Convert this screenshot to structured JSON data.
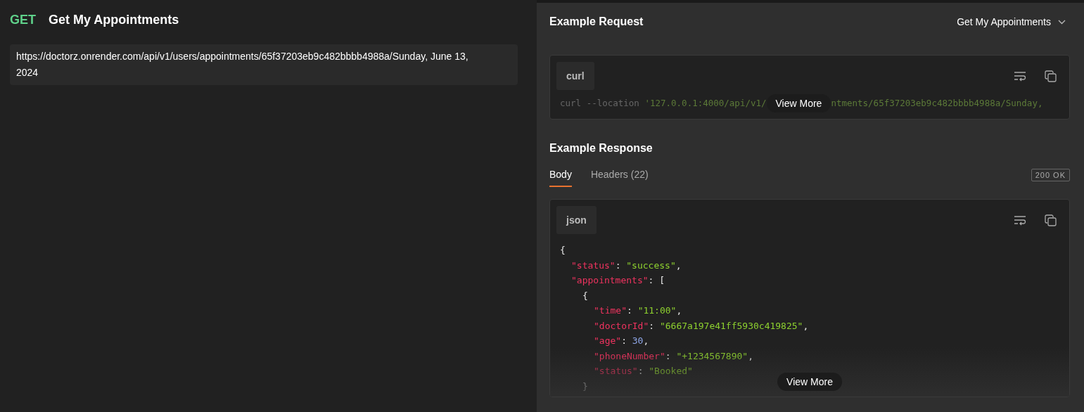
{
  "request": {
    "method": "GET",
    "name": "Get My Appointments",
    "url": "https://doctorz.onrender.com/api/v1/users/appointments/65f37203eb9c482bbbb4988a/Sunday, June 13, 2024"
  },
  "example_request": {
    "title": "Example Request",
    "selector": "Get My Appointments",
    "language": "curl",
    "code_segments": [
      {
        "kind": "plain",
        "text": "curl --location "
      },
      {
        "kind": "string",
        "text": "'127.0.0.1:4000/api/v1/"
      },
      {
        "kind": "string",
        "text": "ntments/65f37203eb9c482bbbb4988a/Sunday,"
      }
    ],
    "view_more": "View More"
  },
  "example_response": {
    "title": "Example Response",
    "tabs": [
      {
        "label": "Body",
        "selected": true
      },
      {
        "label": "Headers (22)",
        "selected": false
      }
    ],
    "status_badge": "200 OK",
    "language": "json",
    "view_more": "View More",
    "lines": [
      {
        "tokens": [
          {
            "kind": "punct",
            "text": "{"
          }
        ],
        "children": [
          {
            "tokens": [
              {
                "kind": "key",
                "text": "\"status\""
              },
              {
                "kind": "punct",
                "text": ": "
              },
              {
                "kind": "string",
                "text": "\"success\""
              },
              {
                "kind": "punct",
                "text": ","
              }
            ]
          },
          {
            "tokens": [
              {
                "kind": "key",
                "text": "\"appointments\""
              },
              {
                "kind": "punct",
                "text": ": ["
              }
            ],
            "children": [
              {
                "tokens": [
                  {
                    "kind": "punct",
                    "text": "{"
                  }
                ],
                "close": [
                  {
                    "kind": "punct",
                    "text": "}"
                  }
                ],
                "children": [
                  {
                    "tokens": [
                      {
                        "kind": "key",
                        "text": "\"time\""
                      },
                      {
                        "kind": "punct",
                        "text": ": "
                      },
                      {
                        "kind": "string",
                        "text": "\"11:00\""
                      },
                      {
                        "kind": "punct",
                        "text": ","
                      }
                    ]
                  },
                  {
                    "tokens": [
                      {
                        "kind": "key",
                        "text": "\"doctorId\""
                      },
                      {
                        "kind": "punct",
                        "text": ": "
                      },
                      {
                        "kind": "string",
                        "text": "\"6667a197e41ff5930c419825\""
                      },
                      {
                        "kind": "punct",
                        "text": ","
                      }
                    ]
                  },
                  {
                    "tokens": [
                      {
                        "kind": "key",
                        "text": "\"age\""
                      },
                      {
                        "kind": "punct",
                        "text": ": "
                      },
                      {
                        "kind": "number",
                        "text": "30"
                      },
                      {
                        "kind": "punct",
                        "text": ","
                      }
                    ]
                  },
                  {
                    "tokens": [
                      {
                        "kind": "key",
                        "text": "\"phoneNumber\""
                      },
                      {
                        "kind": "punct",
                        "text": ": "
                      },
                      {
                        "kind": "string",
                        "text": "\"+1234567890\""
                      },
                      {
                        "kind": "punct",
                        "text": ","
                      }
                    ]
                  },
                  {
                    "tokens": [
                      {
                        "kind": "key",
                        "text": "\"status\""
                      },
                      {
                        "kind": "punct",
                        "text": ": "
                      },
                      {
                        "kind": "string",
                        "text": "\"Booked\""
                      }
                    ]
                  }
                ]
              }
            ]
          }
        ]
      }
    ]
  }
}
